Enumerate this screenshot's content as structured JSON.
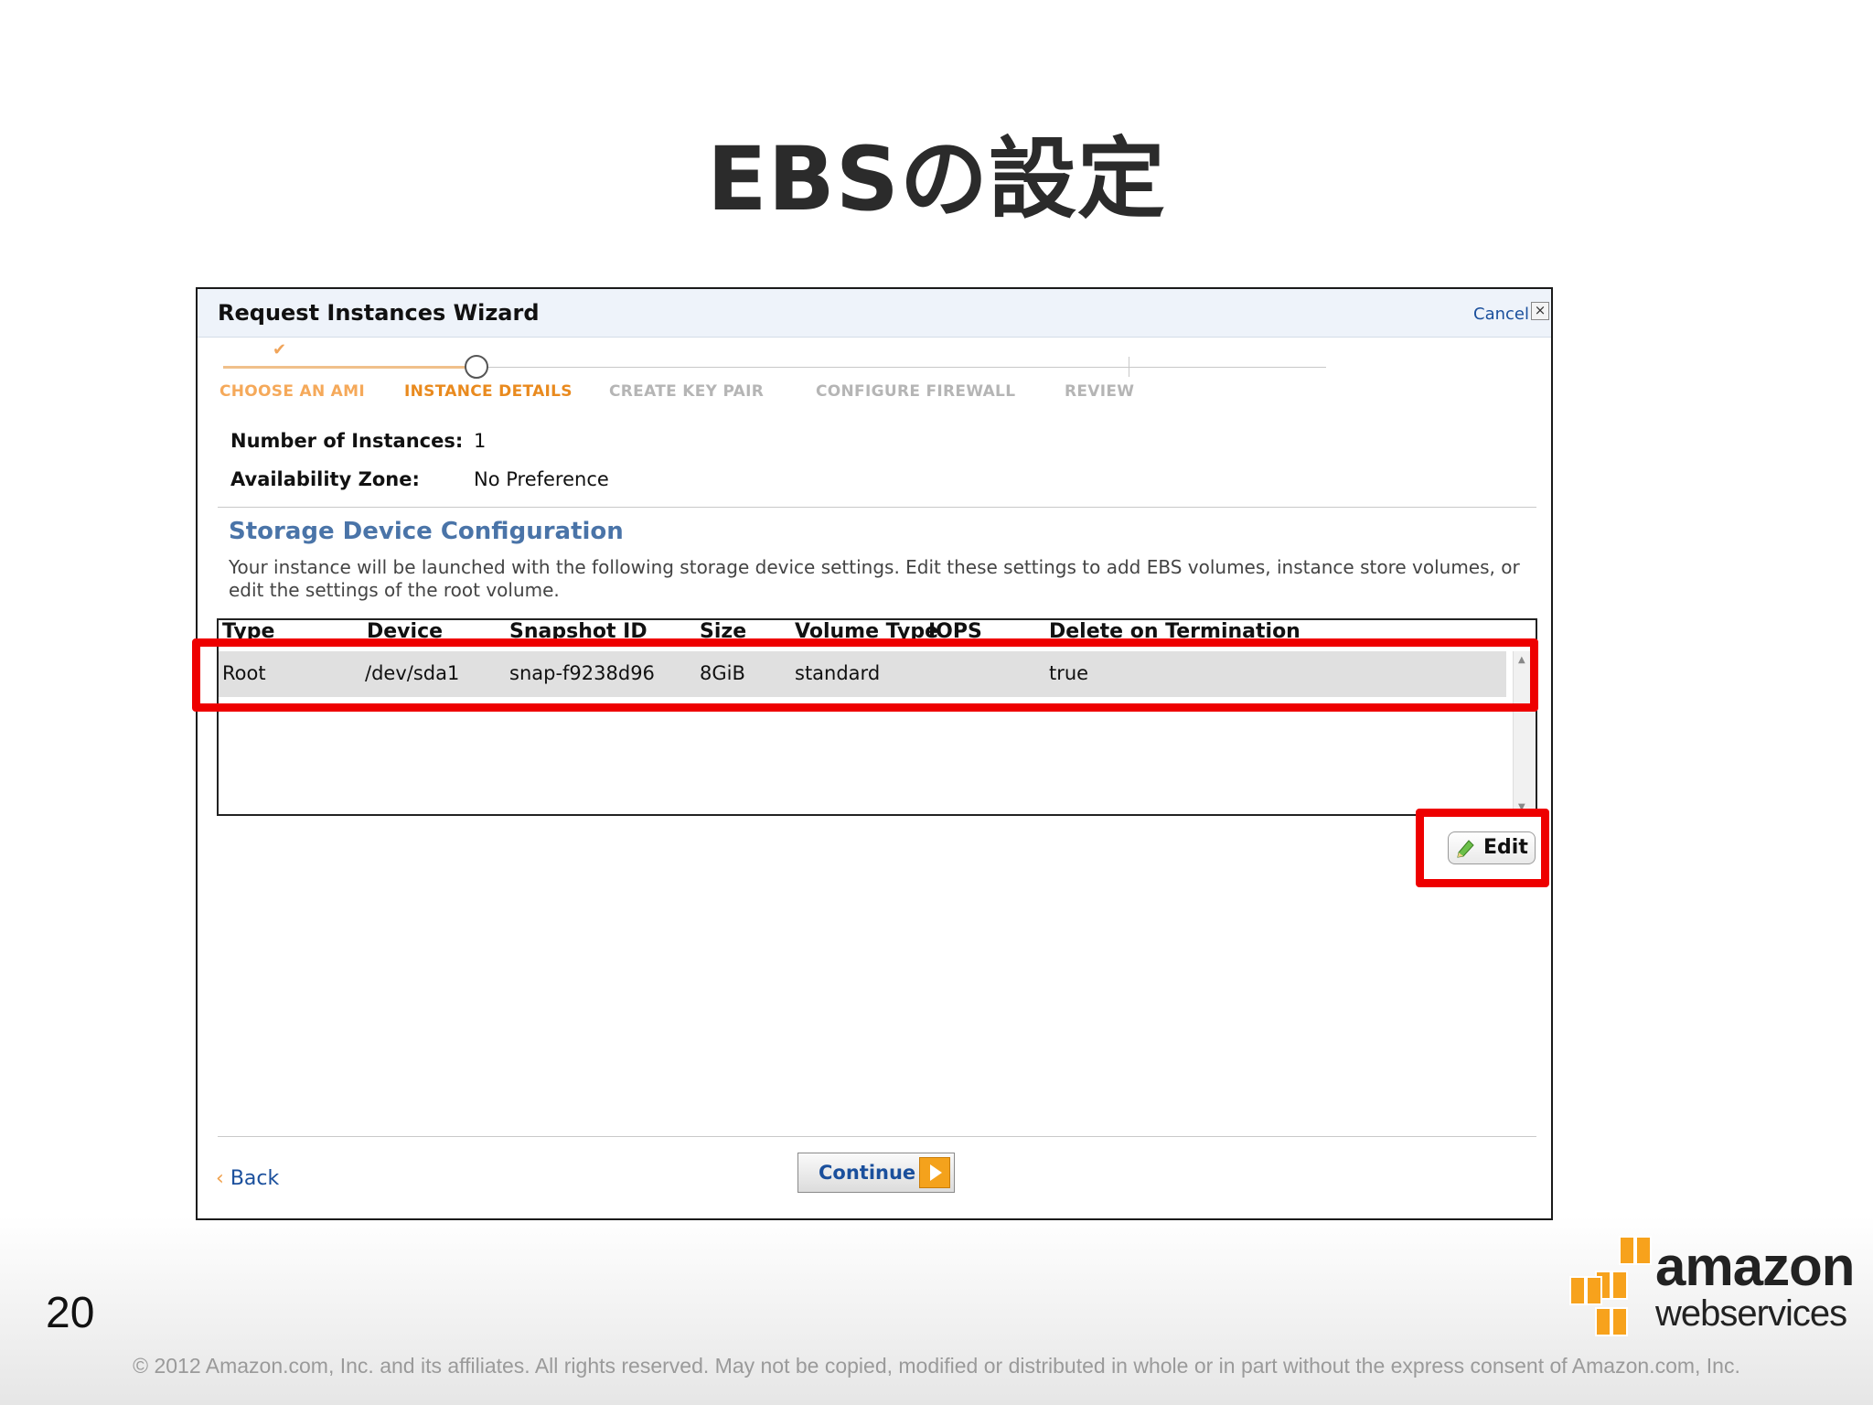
{
  "slide": {
    "title": "EBSの設定",
    "page_number": "20",
    "copyright": "© 2012 Amazon.com, Inc. and its affiliates.  All rights reserved.  May not be copied, modified or distributed in whole or in part without the express consent of Amazon.com, Inc.",
    "logo": {
      "line1": "amazon",
      "line2": "webservices",
      "brand_color": "#f7a21c"
    }
  },
  "wizard": {
    "title": "Request Instances Wizard",
    "cancel_label": "Cancel",
    "close_icon": "×",
    "steps": [
      {
        "label": "CHOOSE AN AMI",
        "state": "done"
      },
      {
        "label": "INSTANCE DETAILS",
        "state": "active"
      },
      {
        "label": "CREATE KEY PAIR",
        "state": "todo"
      },
      {
        "label": "CONFIGURE FIREWALL",
        "state": "todo"
      },
      {
        "label": "REVIEW",
        "state": "todo"
      }
    ],
    "step_check": "✔",
    "fields": {
      "instances_label": "Number of Instances:",
      "instances_value": "1",
      "zone_label": "Availability Zone:",
      "zone_value": "No Preference"
    },
    "storage": {
      "title": "Storage Device Configuration",
      "description": "Your instance will be launched with the following storage device settings. Edit these settings to add EBS volumes, instance store volumes, or edit the settings of the root volume.",
      "columns": [
        "Type",
        "Device",
        "Snapshot ID",
        "Size",
        "Volume Type",
        "IOPS",
        "Delete on Termination"
      ],
      "rows": [
        {
          "type": "Root",
          "device": "/dev/sda1",
          "snapshot": "snap-f9238d96",
          "size": "8GiB",
          "volume_type": "standard",
          "iops": "",
          "delete_on_termination": "true"
        }
      ],
      "edit_label": "Edit"
    },
    "back_label": "Back",
    "back_arrow": "‹",
    "continue_label": "Continue",
    "accent_color": "#ee0000"
  }
}
